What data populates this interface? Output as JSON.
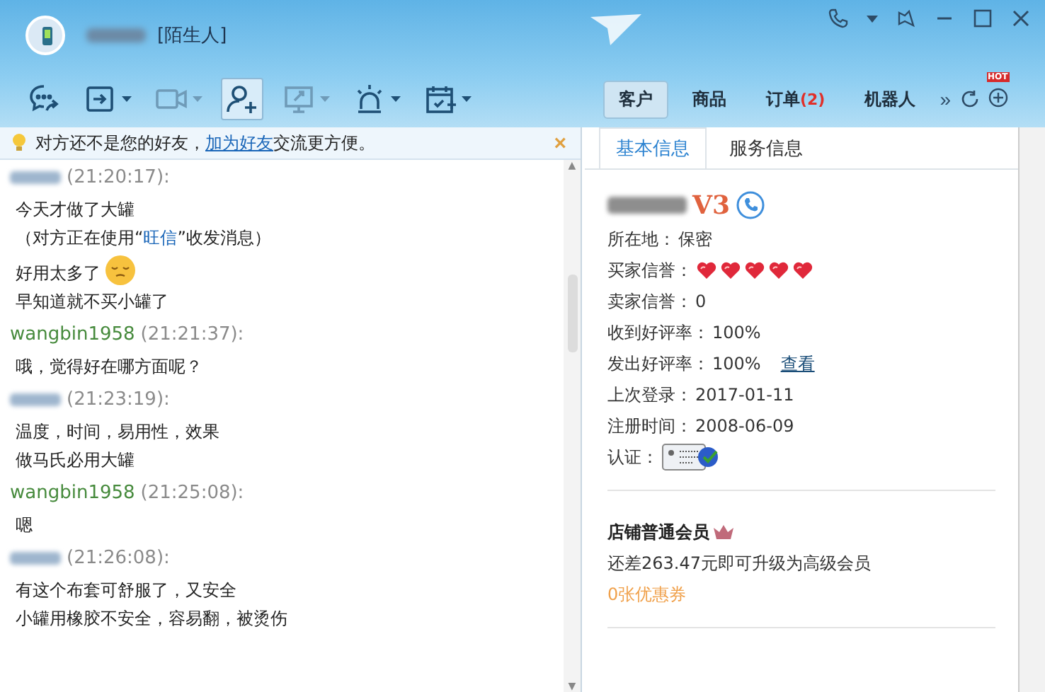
{
  "header": {
    "contact_tag": "[陌生人]"
  },
  "toolbar": [
    {
      "kind": "chat-share",
      "dropdown": false,
      "disabled": false,
      "selected": false
    },
    {
      "kind": "file",
      "dropdown": true,
      "disabled": false,
      "selected": false
    },
    {
      "kind": "video",
      "dropdown": true,
      "disabled": true,
      "selected": false
    },
    {
      "kind": "add-contact",
      "dropdown": false,
      "disabled": false,
      "selected": true
    },
    {
      "kind": "screen",
      "dropdown": true,
      "disabled": true,
      "selected": false
    },
    {
      "kind": "alarm",
      "dropdown": true,
      "disabled": false,
      "selected": false
    },
    {
      "kind": "calendar",
      "dropdown": true,
      "disabled": false,
      "selected": false
    }
  ],
  "notice": {
    "before": "对方还不是您的好友，",
    "link": "加为好友",
    "after": "交流更方便。",
    "close": "×"
  },
  "messages": [
    {
      "kind": "customer",
      "time": "(21:20:17):",
      "lines": [
        {
          "kind": "text",
          "text": "今天才做了大罐"
        },
        {
          "kind": "notice",
          "before": "（对方正在使用“",
          "link": "旺信",
          "after": "”收发消息）"
        },
        {
          "kind": "emoji",
          "text": "好用太多了"
        },
        {
          "kind": "text",
          "text": "早知道就不买小罐了"
        }
      ]
    },
    {
      "kind": "agent",
      "sender": "wangbin1958",
      "time": "(21:21:37):",
      "lines": [
        {
          "kind": "text",
          "text": "哦，觉得好在哪方面呢？"
        }
      ]
    },
    {
      "kind": "customer",
      "time": "(21:23:19):",
      "lines": [
        {
          "kind": "text",
          "text": "温度，时间，易用性，效果"
        },
        {
          "kind": "text",
          "text": "做马氏必用大罐"
        }
      ]
    },
    {
      "kind": "agent",
      "sender": "wangbin1958",
      "time": "(21:25:08):",
      "lines": [
        {
          "kind": "text",
          "text": "嗯"
        }
      ]
    },
    {
      "kind": "customer",
      "time": "(21:26:08):",
      "lines": [
        {
          "kind": "text",
          "text": "有这个布套可舒服了，又安全"
        },
        {
          "kind": "text",
          "text": "小罐用橡胶不安全，容易翻，被烫伤"
        }
      ]
    }
  ],
  "top_tabs": [
    {
      "label": "客户",
      "selected": true
    },
    {
      "label": "商品",
      "selected": false
    },
    {
      "label": "订单",
      "badge": "(2)",
      "selected": false
    },
    {
      "label": "机器人",
      "selected": false
    }
  ],
  "scroll_arrows": {
    "up": "▲",
    "down": "▼"
  },
  "more": "»",
  "hot_badge": "HOT",
  "info_tabs": [
    {
      "label": "基本信息",
      "selected": true
    },
    {
      "label": "服务信息",
      "selected": false
    }
  ],
  "profile": {
    "vip": "V3",
    "fields": [
      {
        "kind": "text",
        "label": "所在地：",
        "value": "保密"
      },
      {
        "kind": "hearts",
        "label": "买家信誉：",
        "stars": 5
      },
      {
        "kind": "text",
        "label": "卖家信誉：",
        "value": "0"
      },
      {
        "kind": "text",
        "label": "收到好评率：",
        "value": "100%"
      },
      {
        "kind": "link",
        "label": "发出好评率：",
        "value": "100%",
        "link": "查看"
      },
      {
        "kind": "text",
        "label": "上次登录：",
        "value": "2017-01-11"
      },
      {
        "kind": "text",
        "label": "注册时间：",
        "value": "2008-06-09"
      },
      {
        "kind": "badge",
        "label": "认证："
      }
    ]
  },
  "membership": {
    "title": "店铺普通会员",
    "upgrade": "还差263.47元即可升级为高级会员",
    "coupons": "0张优惠券"
  }
}
